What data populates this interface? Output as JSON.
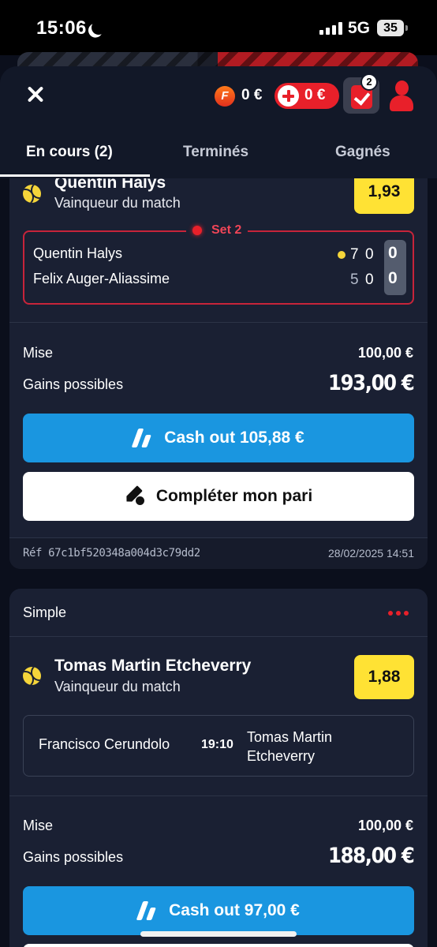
{
  "status_bar": {
    "time": "15:06",
    "network": "5G",
    "battery": "35"
  },
  "header": {
    "freebet_badge": "F",
    "freebet_amount": "0 €",
    "bonus_amount": "0 €",
    "betslip_count": "2"
  },
  "tabs": [
    {
      "label": "En cours (2)",
      "active": true
    },
    {
      "label": "Terminés",
      "active": false
    },
    {
      "label": "Gagnés",
      "active": false
    }
  ],
  "bets": [
    {
      "selection": "Quentin Halys",
      "market": "Vainqueur du match",
      "odds": "1,93",
      "live": {
        "set_label": "Set 2",
        "players": [
          {
            "name": "Quentin Halys",
            "set1": "7",
            "set2": "0",
            "points": "0",
            "serving": true
          },
          {
            "name": "Felix Auger-Aliassime",
            "set1": "5",
            "set2": "0",
            "points": "0",
            "serving": false
          }
        ]
      },
      "stake_label": "Mise",
      "stake": "100,00 €",
      "gains_label": "Gains possibles",
      "gains": "193,00 €",
      "cashout_label": "Cash out 105,88 €",
      "complete_label": "Compléter mon pari",
      "reference": "Réf 67c1bf520348a004d3c79dd2",
      "date": "28/02/2025 14:51"
    },
    {
      "type_label": "Simple",
      "selection": "Tomas Martin Etcheverry",
      "market": "Vainqueur du match",
      "odds": "1,88",
      "match": {
        "home": "Francisco Cerundolo",
        "time": "19:10",
        "away": "Tomas Martin Etcheverry"
      },
      "stake_label": "Mise",
      "stake": "100,00 €",
      "gains_label": "Gains possibles",
      "gains": "188,00 €",
      "cashout_label": "Cash out 97,00 €"
    }
  ],
  "colors": {
    "accent_red": "#e8202a",
    "odds_yellow": "#ffe234",
    "cashout_blue": "#1a96e0",
    "background": "#0b0f1c",
    "card": "#1a2033"
  }
}
